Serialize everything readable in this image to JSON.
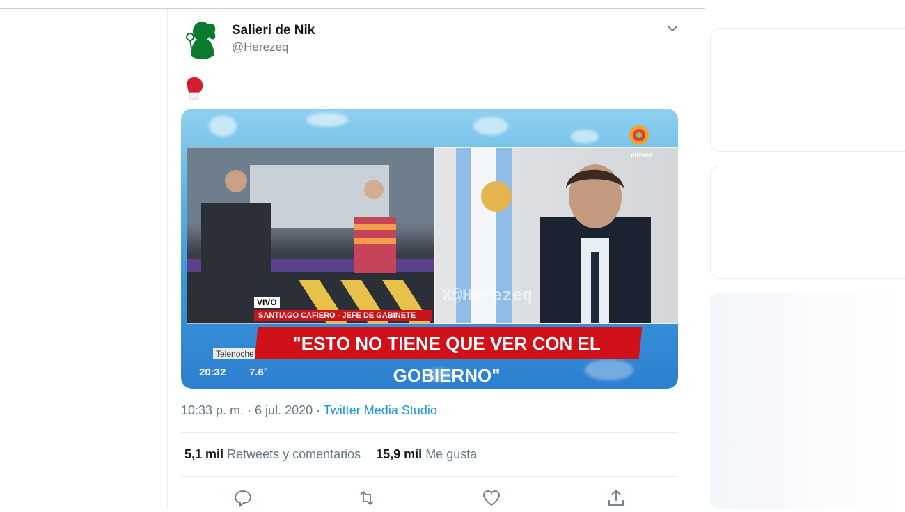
{
  "tweet": {
    "display_name": "Salieri de Nik",
    "handle": "@Herezeq",
    "emoji": "🥊",
    "timestamp": "10:33 p. m. · 6 jul. 2020 · ",
    "source": "Twitter Media Studio",
    "retweets_count": "5,1 mil",
    "retweets_label": "Retweets y comentarios",
    "likes_count": "15,9 mil",
    "likes_label": "Me gusta"
  },
  "video": {
    "headline": "\"ESTO NO TIENE QUE VER CON EL GOBIERNO\"",
    "live_tag": "VIVO",
    "lower_third": "SANTIAGO CAFIERO - JEFE DE GABINETE",
    "program": "Telenoche",
    "clock": "20:32",
    "temperature": "7.6°",
    "watermark": "X@Herezeq",
    "channel": "eltrece",
    "channel_badge": "60"
  },
  "icons": {
    "caret": "chevron-down-icon",
    "reply": "reply-icon",
    "retweet": "retweet-icon",
    "like": "heart-icon",
    "share": "share-icon"
  },
  "colors": {
    "accent": "#1b95e0",
    "muted": "#657786",
    "text": "#14171a",
    "headline_red": "#d0111a"
  }
}
